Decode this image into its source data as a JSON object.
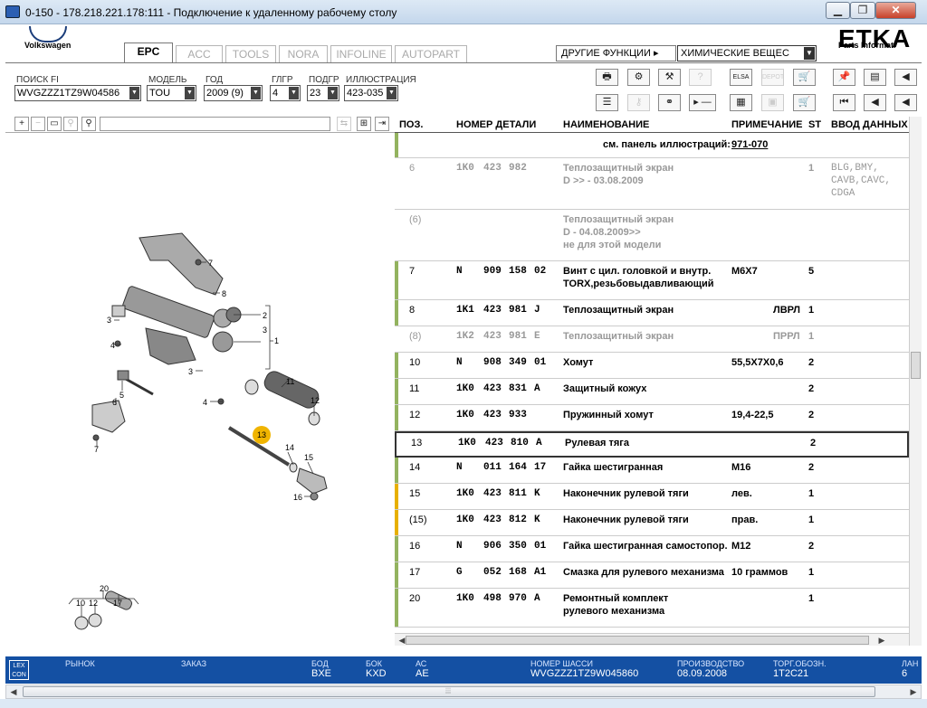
{
  "window": {
    "title": "0-150 - 178.218.221.178:111 - Подключение к удаленному рабочему столу",
    "min_icon": "minimize-icon",
    "max_icon": "maximize-icon",
    "close_icon": "close-icon",
    "min_glyph": "▁",
    "max_glyph": "❐",
    "close_glyph": "✕"
  },
  "brand": {
    "name": "Volkswagen",
    "etka": "ETKA",
    "parts_info": "Parts Informati"
  },
  "tabs": [
    {
      "label": "EPC",
      "active": true
    },
    {
      "label": "ACC",
      "active": false
    },
    {
      "label": "TOOLS",
      "active": false
    },
    {
      "label": "NORA",
      "active": false
    },
    {
      "label": "INFOLINE",
      "active": false
    },
    {
      "label": "AUTOPART",
      "active": false
    }
  ],
  "menu": {
    "other_functions": "ДРУГИЕ ФУНКЦИИ ▸",
    "chemicals": "ХИМИЧЕСКИЕ ВЕЩЕС"
  },
  "filters": {
    "search_fi": {
      "label": "ПОИСК FI",
      "value": "WVGZZZ1TZ9W04586"
    },
    "model": {
      "label": "МОДЕЛЬ",
      "value": "TOU"
    },
    "year": {
      "label": "ГОД",
      "value": "2009 (9)"
    },
    "main_group": {
      "label": "ГЛГР",
      "value": "4"
    },
    "sub_group": {
      "label": "ПОДГР",
      "value": "23"
    },
    "illustration": {
      "label": "ИЛЛЮСТРАЦИЯ",
      "value": "423-035"
    }
  },
  "toolbar": {
    "print": "🖶",
    "elsa": "ELSA",
    "depot": "DEPOT",
    "pin": "📌",
    "play": "▸ —",
    "first": "⏮",
    "prev": "◀"
  },
  "illustration_tools": {
    "zoom_in": "+",
    "zoom_out": "−",
    "zoom_fit": "▭",
    "zoom_reset": "⚲",
    "search": "⚲"
  },
  "diagram": {
    "callouts": [
      "7",
      "8",
      "2",
      "3",
      "3",
      "1",
      "4",
      "3",
      "5",
      "11",
      "12",
      "6",
      "4",
      "13",
      "14",
      "15",
      "7",
      "16",
      "20",
      "10",
      "12",
      "17"
    ],
    "highlighted": "13"
  },
  "table": {
    "headers": {
      "pos": "ПОЗ.",
      "part_no": "НОМЕР ДЕТАЛИ",
      "name": "НАИМЕНОВАНИЕ",
      "note": "ПРИМЕЧАНИЕ",
      "st": "ST",
      "input": "ВВОД ДАННЫХ П"
    },
    "rows": [
      {
        "pos": "",
        "p1": "",
        "p2": "",
        "p3": "",
        "p4": "",
        "name1": "см. панель иллюстраций:",
        "name2": "",
        "name3": "",
        "note": "971-070",
        "st": "",
        "input1": "",
        "input2": "",
        "input3": "",
        "variant": "ref",
        "bar": "green"
      },
      {
        "pos": "6",
        "p1": "1K0",
        "p2": "423",
        "p3": "982",
        "p4": "",
        "name1": "Теплозащитный экран",
        "name2": "D               >> - 03.08.2009",
        "name3": "",
        "note": "",
        "st": "1",
        "input1": "BLG,BMY,",
        "input2": "CAVB,CAVC,",
        "input3": "CDGA",
        "variant": "grey",
        "bar": "none"
      },
      {
        "pos": "(6)",
        "p1": "",
        "p2": "",
        "p3": "",
        "p4": "",
        "name1": "Теплозащитный экран",
        "name2": "D - 04.08.2009>>",
        "name3": "не для этой модели",
        "note": "",
        "st": "",
        "input1": "",
        "input2": "",
        "input3": "",
        "variant": "grey",
        "bar": "none"
      },
      {
        "pos": "7",
        "p1": "N",
        "p2": "909",
        "p3": "158",
        "p4": "02",
        "name1": "Винт с цил. головкой и внутр.",
        "name2": "TORX,резьбовыдавливающий",
        "name3": "",
        "note": "M6X7",
        "st": "5",
        "input1": "",
        "input2": "",
        "input3": "",
        "variant": "normal",
        "bar": "green"
      },
      {
        "pos": "8",
        "p1": "1K1",
        "p2": "423",
        "p3": "981",
        "p4": "J",
        "name1": "Теплозащитный экран",
        "name2": "",
        "name3": "",
        "note": "ЛВРЛ",
        "st": "1",
        "input1": "",
        "input2": "",
        "input3": "",
        "variant": "normal",
        "bar": "green"
      },
      {
        "pos": "(8)",
        "p1": "1K2",
        "p2": "423",
        "p3": "981",
        "p4": "E",
        "name1": "Теплозащитный экран",
        "name2": "",
        "name3": "",
        "note": "ПРРЛ",
        "st": "1",
        "input1": "",
        "input2": "",
        "input3": "",
        "variant": "grey",
        "bar": "none"
      },
      {
        "pos": "10",
        "p1": "N",
        "p2": "908",
        "p3": "349",
        "p4": "01",
        "name1": "Хомут",
        "name2": "",
        "name3": "",
        "note": "55,5X7X0,6",
        "st": "2",
        "input1": "",
        "input2": "",
        "input3": "",
        "variant": "normal",
        "bar": "green"
      },
      {
        "pos": "11",
        "p1": "1K0",
        "p2": "423",
        "p3": "831",
        "p4": "A",
        "name1": "Защитный кожух",
        "name2": "",
        "name3": "",
        "note": "",
        "st": "2",
        "input1": "",
        "input2": "",
        "input3": "",
        "variant": "normal",
        "bar": "green"
      },
      {
        "pos": "12",
        "p1": "1K0",
        "p2": "423",
        "p3": "933",
        "p4": "",
        "name1": "Пружинный хомут",
        "name2": "",
        "name3": "",
        "note": "19,4-22,5",
        "st": "2",
        "input1": "",
        "input2": "",
        "input3": "",
        "variant": "normal",
        "bar": "green"
      },
      {
        "pos": "13",
        "p1": "1K0",
        "p2": "423",
        "p3": "810",
        "p4": "A",
        "name1": "Рулевая тяга",
        "name2": "",
        "name3": "",
        "note": "",
        "st": "2",
        "input1": "",
        "input2": "",
        "input3": "",
        "variant": "selected",
        "bar": "none"
      },
      {
        "pos": "14",
        "p1": "N",
        "p2": "011",
        "p3": "164",
        "p4": "17",
        "name1": "Гайка шестигранная",
        "name2": "",
        "name3": "",
        "note": "M16",
        "st": "2",
        "input1": "",
        "input2": "",
        "input3": "",
        "variant": "normal",
        "bar": "green"
      },
      {
        "pos": "15",
        "p1": "1K0",
        "p2": "423",
        "p3": "811",
        "p4": "K",
        "name1": "Наконечник рулевой тяги",
        "name2": "",
        "name3": "",
        "note": "лев.",
        "st": "1",
        "input1": "",
        "input2": "",
        "input3": "",
        "variant": "normal",
        "bar": "orange"
      },
      {
        "pos": "(15)",
        "p1": "1K0",
        "p2": "423",
        "p3": "812",
        "p4": "K",
        "name1": "Наконечник рулевой тяги",
        "name2": "",
        "name3": "",
        "note": "прав.",
        "st": "1",
        "input1": "",
        "input2": "",
        "input3": "",
        "variant": "normal",
        "bar": "orange"
      },
      {
        "pos": "16",
        "p1": "N",
        "p2": "906",
        "p3": "350",
        "p4": "01",
        "name1": "Гайка шестигранная самостопор.",
        "name2": "",
        "name3": "",
        "note": "M12",
        "st": "2",
        "input1": "",
        "input2": "",
        "input3": "",
        "variant": "normal",
        "bar": "green"
      },
      {
        "pos": "17",
        "p1": "G",
        "p2": "052",
        "p3": "168",
        "p4": "A1",
        "name1": "Смазка для рулевого механизма",
        "name2": "",
        "name3": "",
        "note": "10 граммов",
        "st": "1",
        "input1": "",
        "input2": "",
        "input3": "",
        "variant": "normal",
        "bar": "green"
      },
      {
        "pos": "20",
        "p1": "1K0",
        "p2": "498",
        "p3": "970",
        "p4": "A",
        "name1": "Ремонтный комплект",
        "name2": "рулевого механизма",
        "name3": "",
        "note": "",
        "st": "1",
        "input1": "",
        "input2": "",
        "input3": "",
        "variant": "normal",
        "bar": "green"
      }
    ]
  },
  "status": {
    "logo": "LEX CON",
    "market_label": "РЫНОК",
    "market_value": "",
    "order_label": "ЗАКАЗ",
    "order_value": "",
    "bod_label": "БОД",
    "bod_value": "BXE",
    "bok_label": "БОК",
    "bok_value": "KXD",
    "ac_label": "АС",
    "ac_value": "AE",
    "chassis_label": "НОМЕР ШАССИ",
    "chassis_value": "WVGZZZ1TZ9W045860",
    "production_label": "ПРОИЗВОДСТВО",
    "production_value": "08.09.2008",
    "trade_label": "ТОРГ.ОБОЗН.",
    "trade_value": "1T2C21",
    "lang_label": "ЛАН",
    "lang_value": "6"
  },
  "scroll": {
    "left": "◀",
    "right": "▶",
    "grip": "⦙⦙⦙"
  }
}
